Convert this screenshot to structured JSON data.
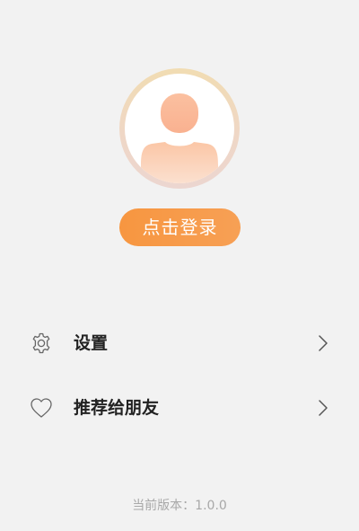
{
  "profile": {
    "avatar_icon": "user-avatar-icon",
    "login_label": "点击登录"
  },
  "menu": {
    "items": [
      {
        "icon": "gear-icon",
        "label": "设置",
        "chevron": "chevron-right-icon"
      },
      {
        "icon": "heart-icon",
        "label": "推荐给朋友",
        "chevron": "chevron-right-icon"
      }
    ]
  },
  "footer": {
    "version": "当前版本：1.0.0"
  },
  "colors": {
    "background": "#f2f2f2",
    "accent": "#f79640",
    "avatar_ring": "#f1dcb2",
    "icon_gray": "#666666",
    "version_gray": "#a8a8a8"
  }
}
